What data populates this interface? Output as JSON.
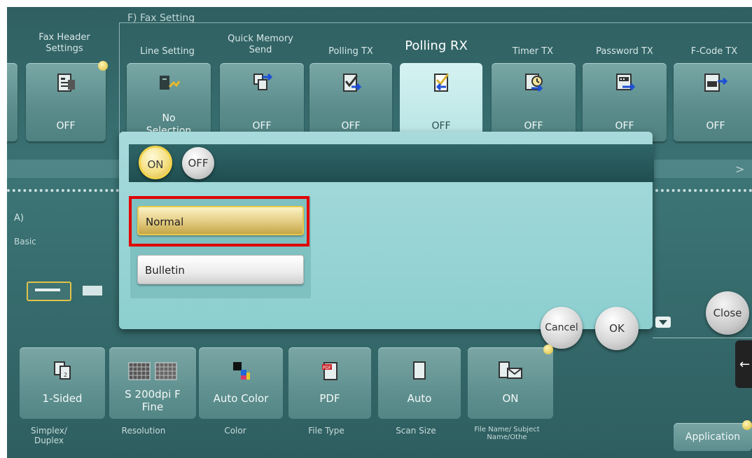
{
  "fax_setting": {
    "section_title": "F)  Fax Setting"
  },
  "tabs": [
    {
      "title": "Fax Header Settings",
      "value": "OFF"
    },
    {
      "title": "Line Setting",
      "value": "No Selection"
    },
    {
      "title": "Quick Memory Send",
      "value": "OFF"
    },
    {
      "title": "Polling TX",
      "value": "OFF"
    },
    {
      "title": "Polling RX",
      "value": "OFF"
    },
    {
      "title": "Timer TX",
      "value": "OFF"
    },
    {
      "title": "Password TX",
      "value": "OFF"
    },
    {
      "title": "F-Code TX",
      "value": "OFF"
    }
  ],
  "left_panel": {
    "section_label": "A)",
    "basic_label": "Basic"
  },
  "popup": {
    "on_label": "ON",
    "off_label": "OFF",
    "options": [
      "Normal",
      "Bulletin"
    ],
    "selected": "Normal",
    "cancel_label": "Cancel",
    "ok_label": "OK"
  },
  "close_label": "Close",
  "bottom_items": [
    {
      "value": "1-Sided",
      "caption": "Simplex/ Duplex",
      "icon": "simplex-icon"
    },
    {
      "value": "S 200dpi F Fine",
      "caption": "Resolution",
      "icon": "resolution-icon"
    },
    {
      "value": "Auto Color",
      "caption": "Color",
      "icon": "color-icon"
    },
    {
      "value": "PDF",
      "caption": "File Type",
      "icon": "pdf-icon"
    },
    {
      "value": "Auto",
      "caption": "Scan Size",
      "icon": "page-icon"
    },
    {
      "value": "ON",
      "caption": "File Name/ Subject Name/Othe",
      "icon": "mail-icon"
    }
  ],
  "application_label": "Application",
  "colors": {
    "accent_yellow": "#e8c94a",
    "highlight_red": "#e00000",
    "panel_teal": "#a6dadb"
  }
}
